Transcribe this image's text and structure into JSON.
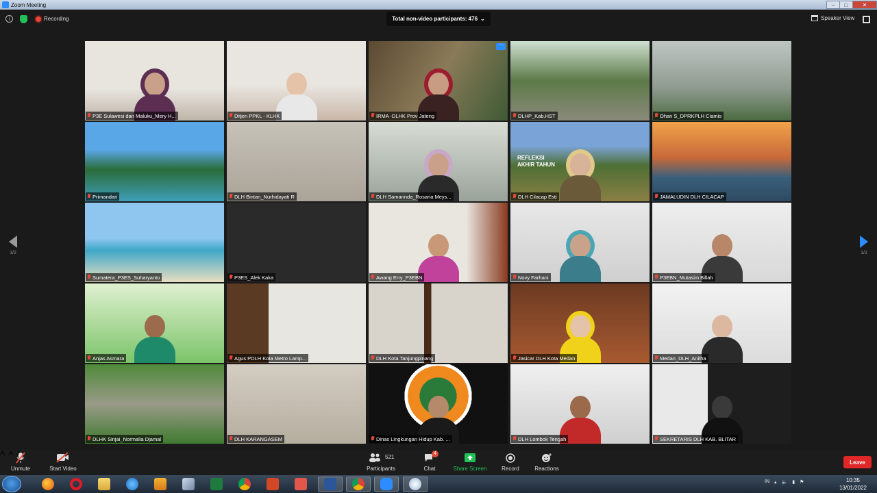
{
  "window": {
    "title": "Zoom Meeting",
    "controls": [
      "–",
      "□",
      "✕"
    ]
  },
  "topbar": {
    "recording_label": "Recording",
    "nonvideo_label": "Total non-video participants: 476",
    "nonvideo_caret": "⌄",
    "speaker_view_label": "Speaker View"
  },
  "pager": {
    "page_left": "1/2",
    "page_right": "1/2"
  },
  "tiles": [
    {
      "name": "P3E Sulawesi dan Maluku_Mery H...",
      "active": true
    },
    {
      "name": "Ditjen PPKL - KLHK"
    },
    {
      "name": "IRMA -DLHK Prov Jateng",
      "more": "···"
    },
    {
      "name": "DLHP_Kab.HST"
    },
    {
      "name": "Ohan S_DPRKPLH Ciamis"
    },
    {
      "name": "Primandari"
    },
    {
      "name": "DLH Bintan_Nurhidayati R"
    },
    {
      "name": "DLH Samarinda_Rosaria Meys..."
    },
    {
      "name": "DLH Cilacap Esti",
      "overlay": "REFLEKSI AKHIR TAHUN"
    },
    {
      "name": "JAMALUDIN DLH CILACAP"
    },
    {
      "name": "Sumatera_P3ES_Suharyanto"
    },
    {
      "name": "P3ES_Alek Kaka"
    },
    {
      "name": "Awang Erry_P3EBN"
    },
    {
      "name": "Novy Farhani"
    },
    {
      "name": "P3EBN_Mutasim Billah"
    },
    {
      "name": "Anjas Asmara"
    },
    {
      "name": "Agus PDLH Kota Metro Lamp..."
    },
    {
      "name": "DLH Kota Tanjungpinang"
    },
    {
      "name": "Jasicar DLH Kota Medan"
    },
    {
      "name": "Medan_DLH_Anitha"
    },
    {
      "name": "DLHK Sinjai_Normalia Djamal"
    },
    {
      "name": "DLH KARANGASEM"
    },
    {
      "name": "Dinas Lingkungan Hidup Kab. ..."
    },
    {
      "name": "DLH Lombok Tengah"
    },
    {
      "name": "SEKRETARIS DLH KAB. BLITAR"
    }
  ],
  "toolbar": {
    "unmute": "Unmute",
    "start_video": "Start Video",
    "participants": "Participants",
    "participants_count": "521",
    "chat": "Chat",
    "chat_badge": "4",
    "share_screen": "Share Screen",
    "record": "Record",
    "reactions": "Reactions",
    "leave": "Leave",
    "caret": "^"
  },
  "taskbar": {
    "lang": "IN",
    "time": "10:35",
    "date": "13/01/2022"
  },
  "colors": {
    "accent": "#2d8cff",
    "share": "#23c05a",
    "leave": "#e02828",
    "active_border": "#d8e35a"
  }
}
